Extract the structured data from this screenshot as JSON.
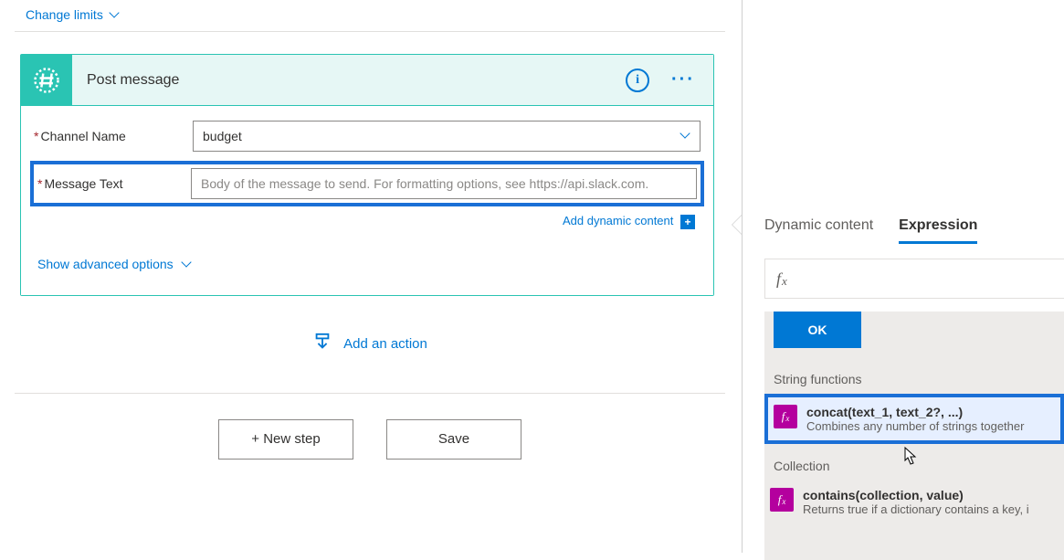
{
  "top": {
    "change_limits": "Change limits"
  },
  "card": {
    "title": "Post message",
    "channel": {
      "label": "Channel Name",
      "value": "budget"
    },
    "message": {
      "label": "Message Text",
      "placeholder": "Body of the message to send. For formatting options, see https://api.slack.com."
    },
    "dynamic_link": "Add dynamic content",
    "advanced": "Show advanced options"
  },
  "flow": {
    "add_action": "Add an action",
    "new_step": "+ New step",
    "save": "Save"
  },
  "panel": {
    "tabs": {
      "dynamic": "Dynamic content",
      "expression": "Expression"
    },
    "fx_label": "fx",
    "ok": "OK",
    "groups": {
      "string": "String functions",
      "collection": "Collection"
    },
    "fns": {
      "concat": {
        "sig": "concat(text_1, text_2?, ...)",
        "desc": "Combines any number of strings together"
      },
      "contains": {
        "sig": "contains(collection, value)",
        "desc": "Returns true if a dictionary contains a key, i"
      }
    }
  }
}
